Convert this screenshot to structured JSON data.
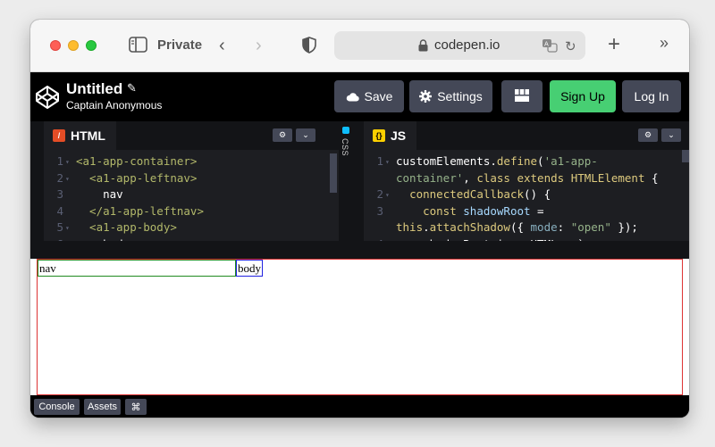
{
  "browser": {
    "private_label": "Private",
    "url": "codepen.io",
    "back_glyph": "‹",
    "forward_glyph": "›",
    "new_tab_glyph": "+",
    "more_glyph": "»",
    "reload_glyph": "↻"
  },
  "header": {
    "title": "Untitled",
    "author": "Captain Anonymous",
    "save_label": "Save",
    "settings_label": "Settings",
    "signup_label": "Sign Up",
    "login_label": "Log In",
    "pencil_glyph": "✎"
  },
  "editors": {
    "html_tab": "HTML",
    "css_tab": "CSS",
    "js_tab": "JS",
    "html_badge": "/",
    "js_badge": "{}",
    "settings_glyph": "⚙",
    "collapse_glyph": "⌄",
    "html_lines": [
      {
        "n": "1",
        "fold": "▾",
        "segments": [
          {
            "t": "<a1-app-container>",
            "c": "tag"
          }
        ]
      },
      {
        "n": "2",
        "fold": "▾",
        "segments": [
          {
            "t": "  <a1-app-leftnav>",
            "c": "tag"
          }
        ]
      },
      {
        "n": "3",
        "fold": "",
        "segments": [
          {
            "t": "    nav",
            "c": "plain"
          }
        ]
      },
      {
        "n": "4",
        "fold": "",
        "segments": [
          {
            "t": "  </a1-app-leftnav>",
            "c": "tag"
          }
        ]
      },
      {
        "n": "5",
        "fold": "▾",
        "segments": [
          {
            "t": "  <a1-app-body>",
            "c": "tag"
          }
        ]
      },
      {
        "n": "6",
        "fold": "",
        "segments": [
          {
            "t": "    body",
            "c": "plain"
          }
        ]
      }
    ],
    "js_lines": [
      {
        "n": "1",
        "fold": "▾",
        "segments": [
          {
            "t": "customElements.",
            "c": "plain"
          },
          {
            "t": "define",
            "c": "fn"
          },
          {
            "t": "(",
            "c": "plain"
          },
          {
            "t": "'a1-app-",
            "c": "str"
          }
        ]
      },
      {
        "n": "",
        "fold": "",
        "segments": [
          {
            "t": "container'",
            "c": "str"
          },
          {
            "t": ", ",
            "c": "plain"
          },
          {
            "t": "class extends ",
            "c": "kw"
          },
          {
            "t": "HTMLElement",
            "c": "kw"
          },
          {
            "t": " {",
            "c": "plain"
          }
        ]
      },
      {
        "n": "2",
        "fold": "▾",
        "segments": [
          {
            "t": "  ",
            "c": "plain"
          },
          {
            "t": "connectedCallback",
            "c": "fn"
          },
          {
            "t": "() {",
            "c": "plain"
          }
        ]
      },
      {
        "n": "3",
        "fold": "",
        "segments": [
          {
            "t": "    ",
            "c": "plain"
          },
          {
            "t": "const ",
            "c": "kw"
          },
          {
            "t": "shadowRoot",
            "c": "var"
          },
          {
            "t": " =",
            "c": "plain"
          }
        ]
      },
      {
        "n": "",
        "fold": "",
        "segments": [
          {
            "t": "this",
            "c": "kw"
          },
          {
            "t": ".",
            "c": "plain"
          },
          {
            "t": "attachShadow",
            "c": "fn"
          },
          {
            "t": "({ ",
            "c": "plain"
          },
          {
            "t": "mode",
            "c": "prop"
          },
          {
            "t": ": ",
            "c": "plain"
          },
          {
            "t": "\"open\"",
            "c": "str"
          },
          {
            "t": " });",
            "c": "plain"
          }
        ]
      },
      {
        "n": "4",
        "fold": "",
        "segments": [
          {
            "t": "    shadowRoot.innerHTML = `",
            "c": "plain"
          }
        ]
      }
    ]
  },
  "preview": {
    "nav_text": "nav",
    "body_text": "body"
  },
  "footer": {
    "console_label": "Console",
    "assets_label": "Assets",
    "shortcut_glyph": "⌘"
  }
}
